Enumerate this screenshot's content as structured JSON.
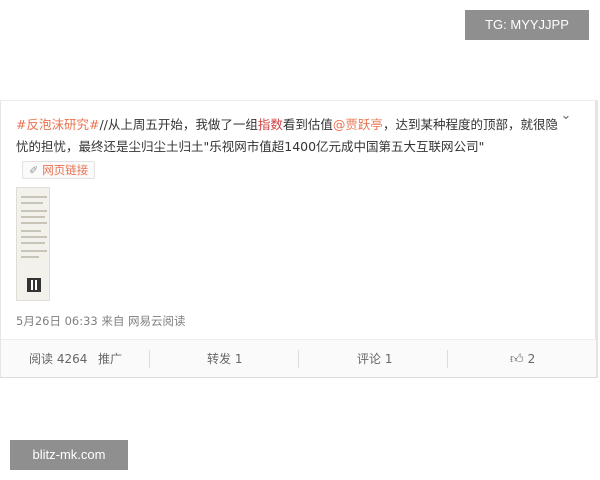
{
  "watermarks": {
    "top": "TG: MYYJJPP",
    "bottom": "blitz-mk.com"
  },
  "post": {
    "tag": "#反泡沫研究#",
    "text_1": "//从上周五开始，我做了一组",
    "highlight": "指数",
    "text_2": "看到估值",
    "mention": "@贾跃亭",
    "text_3": "，达到某种程度的顶部，就很隐忧的担忧，最终还是尘归尘土归土\"乐视网市值超1400亿元成中国第五大互联网公司\"",
    "web_link_label": "网页链接",
    "web_link_icon": "link-icon"
  },
  "meta": {
    "timestamp": "5月26日 06:33",
    "source": "来自 网易云阅读"
  },
  "actions": {
    "reads": "阅读 4264",
    "promote": "推广",
    "repost": "转发 1",
    "comment": "评论 1",
    "like_count": "2",
    "like_icon": "thumbs-up-icon"
  }
}
